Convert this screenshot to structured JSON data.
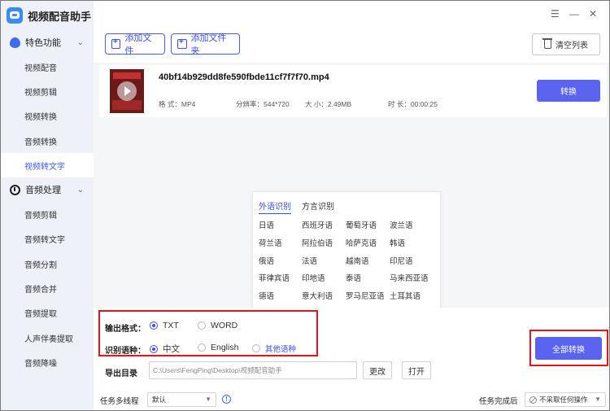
{
  "app": {
    "title": "视频配音助手"
  },
  "sidebar": {
    "groups": [
      {
        "label": "特色功能",
        "items": [
          "视频配音",
          "视频剪辑",
          "视频转换",
          "音频转换",
          "视频转文字"
        ]
      },
      {
        "label": "音频处理",
        "items": [
          "音频剪辑",
          "音频转文字",
          "音频分割",
          "音频合并",
          "音频提取",
          "人声伴奏提取",
          "音频降噪"
        ]
      }
    ],
    "active_item": "视频转文字"
  },
  "toolbar": {
    "add_file": "添加文件",
    "add_folder": "添加文件夹",
    "clear_list": "清空列表"
  },
  "file": {
    "name": "40bf14b929dd8fe590fbde11cf7f7f70.mp4",
    "format": "格 式：MP4",
    "resolution": "分辨率：544*720",
    "size": "大 小：2.49MB",
    "duration": "时 长：00:00:25",
    "convert_label": "转换"
  },
  "language_panel": {
    "tabs": [
      "外语识别",
      "方言识别"
    ],
    "languages": [
      "日语",
      "西班牙语",
      "葡萄牙语",
      "波兰语",
      "荷兰语",
      "阿拉伯语",
      "哈萨克语",
      "韩语",
      "俄语",
      "法语",
      "越南语",
      "印尼语",
      "菲律宾语",
      "印地语",
      "泰语",
      "马来西亚语",
      "德语",
      "意大利语",
      "罗马尼亚语",
      "土耳其语"
    ]
  },
  "settings": {
    "output_format_label": "输出格式：",
    "format_options": [
      "TXT",
      "WORD"
    ],
    "language_label": "识别语种：",
    "language_options": [
      "中文",
      "English"
    ],
    "other_languages": "其他语种",
    "export_dir_label": "导出目录",
    "export_path": "C:\\Users\\FengPing\\Desktop\\视频配音助手",
    "change_label": "更改",
    "open_label": "打开",
    "threads_label": "任务多线程",
    "threads_value": "默认",
    "after_label": "任务完成后",
    "after_value": "不采取任何操作",
    "convert_all": "全部转换"
  },
  "colors": {
    "accent": "#5b64ef",
    "highlight": "#e2141c",
    "sidebar_bg": "#eef1f8"
  }
}
